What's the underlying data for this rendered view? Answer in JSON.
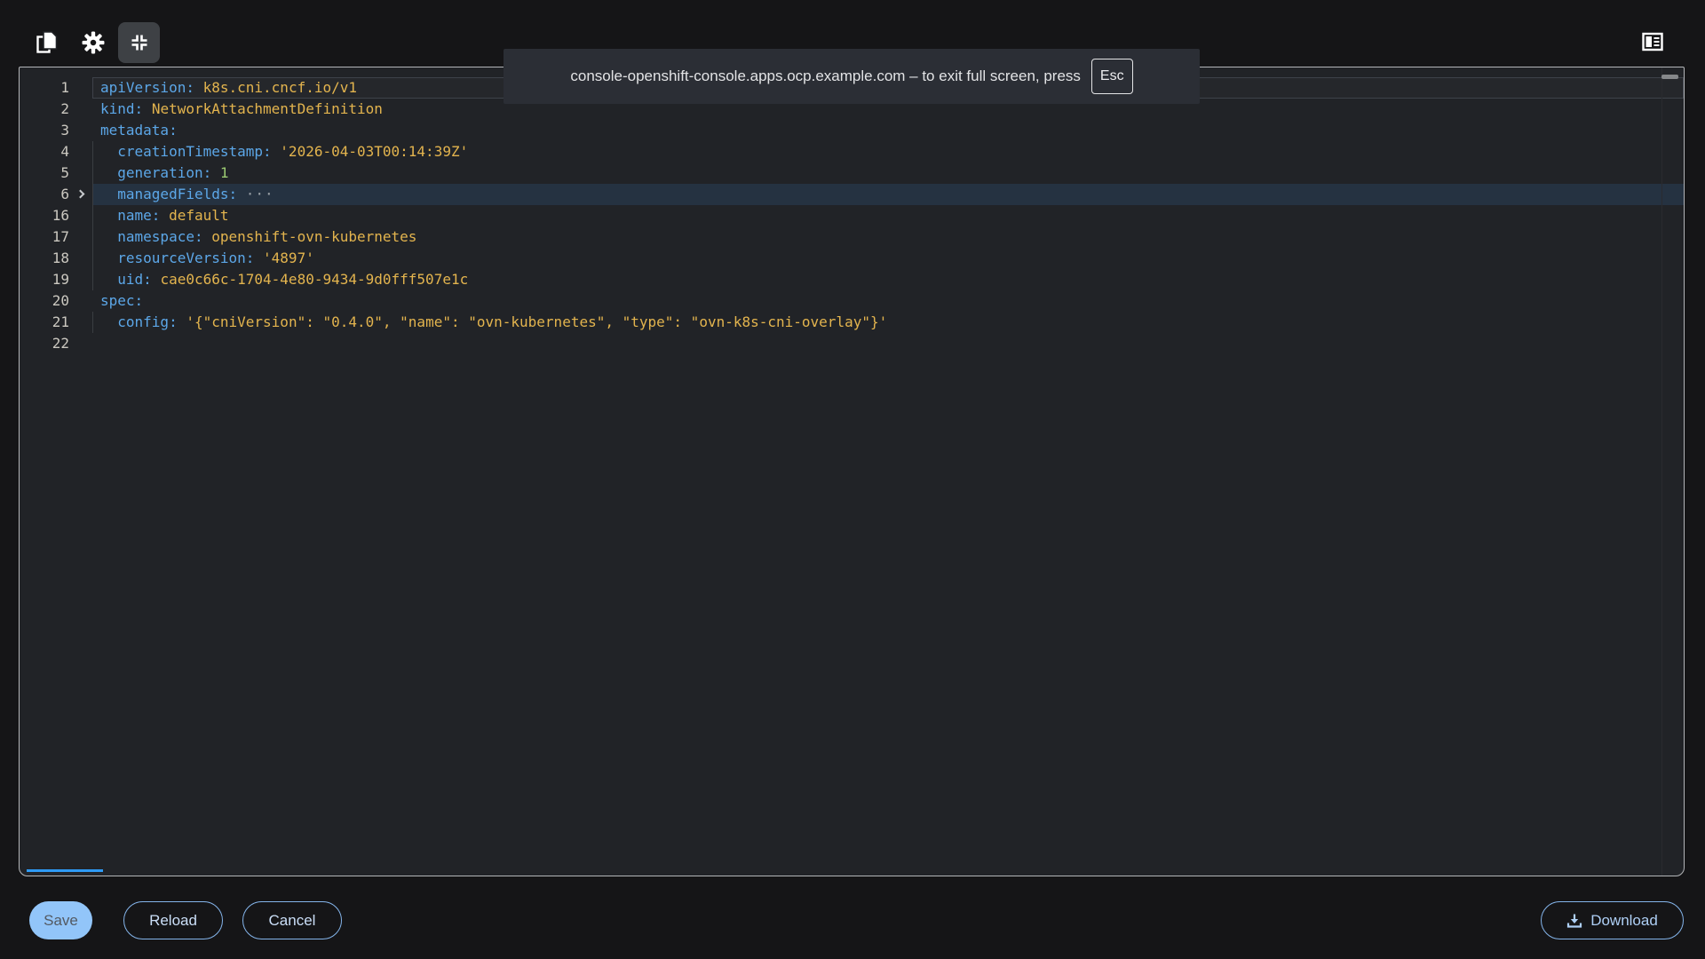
{
  "toast": {
    "text": "console-openshift-console.apps.ocp.example.com – to exit full screen, press",
    "key_label": "Esc"
  },
  "toolbar": {
    "icons": [
      "copy-icon",
      "gear-icon",
      "compress-icon",
      "sidebar-toggle-icon"
    ]
  },
  "editor": {
    "language": "yaml",
    "folded_range": "7-15",
    "lines": [
      {
        "num": "1",
        "box": true,
        "tokens": [
          [
            "k",
            "apiVersion:"
          ],
          [
            "p",
            " "
          ],
          [
            "v",
            "k8s.cni.cncf.io/v1"
          ]
        ]
      },
      {
        "num": "2",
        "tokens": [
          [
            "k",
            "kind:"
          ],
          [
            "p",
            " "
          ],
          [
            "v",
            "NetworkAttachmentDefinition"
          ]
        ]
      },
      {
        "num": "3",
        "tokens": [
          [
            "k",
            "metadata:"
          ]
        ]
      },
      {
        "num": "4",
        "indent": true,
        "tokens": [
          [
            "k",
            "creationTimestamp:"
          ],
          [
            "p",
            " "
          ],
          [
            "v",
            "'2026-04-03T00:14:39Z'"
          ]
        ]
      },
      {
        "num": "5",
        "indent": true,
        "tokens": [
          [
            "k",
            "generation:"
          ],
          [
            "p",
            " "
          ],
          [
            "n",
            "1"
          ]
        ]
      },
      {
        "num": "6",
        "indent": true,
        "fold": true,
        "hl": true,
        "tokens": [
          [
            "k",
            "managedFields:"
          ],
          [
            "p",
            " "
          ],
          [
            "f",
            "···"
          ]
        ]
      },
      {
        "num": "16",
        "indent": true,
        "tokens": [
          [
            "k",
            "name:"
          ],
          [
            "p",
            " "
          ],
          [
            "v",
            "default"
          ]
        ]
      },
      {
        "num": "17",
        "indent": true,
        "tokens": [
          [
            "k",
            "namespace:"
          ],
          [
            "p",
            " "
          ],
          [
            "v",
            "openshift-ovn-kubernetes"
          ]
        ]
      },
      {
        "num": "18",
        "indent": true,
        "tokens": [
          [
            "k",
            "resourceVersion:"
          ],
          [
            "p",
            " "
          ],
          [
            "v",
            "'4897'"
          ]
        ]
      },
      {
        "num": "19",
        "indent": true,
        "tokens": [
          [
            "k",
            "uid:"
          ],
          [
            "p",
            " "
          ],
          [
            "v",
            "cae0c66c-1704-4e80-9434-9d0fff507e1c"
          ]
        ]
      },
      {
        "num": "20",
        "tokens": [
          [
            "k",
            "spec:"
          ]
        ]
      },
      {
        "num": "21",
        "indent": true,
        "tokens": [
          [
            "k",
            "config:"
          ],
          [
            "p",
            " "
          ],
          [
            "v",
            "'{\"cniVersion\": \"0.4.0\", \"name\": \"ovn-kubernetes\", \"type\": \"ovn-k8s-cni-overlay\"}'"
          ]
        ]
      },
      {
        "num": "22",
        "tokens": []
      }
    ]
  },
  "footer": {
    "save_label": "Save",
    "reload_label": "Reload",
    "cancel_label": "Cancel",
    "download_label": "Download"
  },
  "colors": {
    "page_bg": "#151517",
    "editor_bg": "#212327",
    "toast_bg": "#2B2E35",
    "line_highlight": "#253241",
    "key": "#5CA7E8",
    "value": "#E3B44E",
    "number": "#9CCB72",
    "accent": "#92C5F9"
  }
}
